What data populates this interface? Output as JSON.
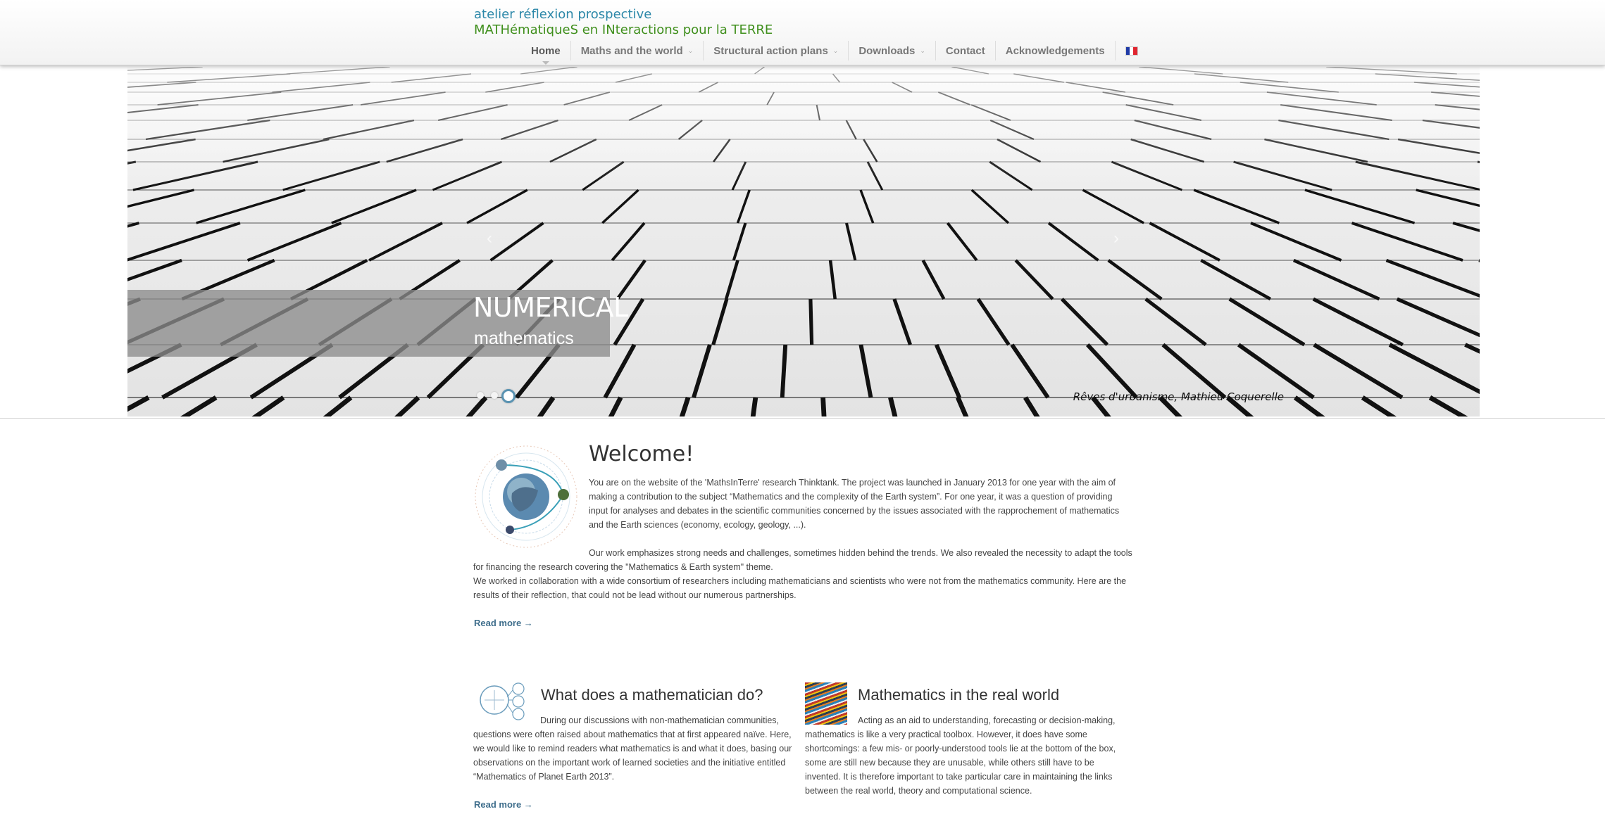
{
  "brand": {
    "line1": "atelier réflexion prospective",
    "line2": "MATHématiqueS en INteractions  pour la TERRE"
  },
  "nav": {
    "items": [
      {
        "label": "Home",
        "active": true,
        "has_dropdown": false
      },
      {
        "label": "Maths and the world",
        "active": false,
        "has_dropdown": true
      },
      {
        "label": "Structural action plans",
        "active": false,
        "has_dropdown": true
      },
      {
        "label": "Downloads",
        "active": false,
        "has_dropdown": true
      },
      {
        "label": "Contact",
        "active": false,
        "has_dropdown": false
      },
      {
        "label": "Acknowledgements",
        "active": false,
        "has_dropdown": false
      }
    ],
    "language_flag": "french-flag-icon",
    "caret_glyph": "⌄"
  },
  "slider": {
    "caption_title": "NUMERICAL",
    "caption_subtitle": "mathematics",
    "credit": "Rêves d'urbanisme, Mathieu Coquerelle",
    "dots": 3,
    "active_dot": 3,
    "prev_glyph": "‹",
    "next_glyph": "›"
  },
  "welcome": {
    "title": "Welcome!",
    "paragraph1": "You are on the website of the 'MathsInTerre' research Thinktank. The project was launched in January 2013 for one year with the aim of making a contribution to the subject “Mathematics and the complexity of the Earth system”. For one year, it was a question of providing input for analyses and debates in the scientific communities concerned by the issues associated with the rapprochement of mathematics and the Earth sciences (economy, ecology, geology, ...).",
    "paragraph2": "Our work emphasizes strong needs and challenges, sometimes hidden behind the trends. We also revealed the necessity to adapt the tools for financing the research covering the \"Mathematics & Earth system\" theme.",
    "paragraph3": "We worked in collaboration with a wide consortium of researchers including mathematicians and scientists who were not from the mathematics community. Here are the results of their reflection, that could not be lead without our numerous partnerships.",
    "read_more": "Read more →"
  },
  "columns": [
    {
      "title": "What does a mathematician do?",
      "text": "During our discussions with non-mathematician communities, questions were often raised about mathematics that at first appeared naïve. Here, we would like to remind readers what mathematics is and what it does, basing our observations on the important work of learned societies and the initiative entitled “Mathematics of Planet Earth 2013”.",
      "read_more": "Read more →"
    },
    {
      "title": "Mathematics in the real world",
      "text": "Acting as an aid to understanding, forecasting or decision-making, mathematics is like a very practical toolbox. However, it does have some shortcomings: a few mis- or poorly-understood tools lie at the bottom of the box, some are still new because they are unusable, while others still have to be invented. It is therefore important to take particular care in maintaining the links between the real world, theory and computational science."
    }
  ],
  "colors": {
    "brand_blue": "#2b87a8",
    "brand_green": "#3f8f1c",
    "link": "#3f6e8c",
    "dot_active": "#5a93b2"
  }
}
